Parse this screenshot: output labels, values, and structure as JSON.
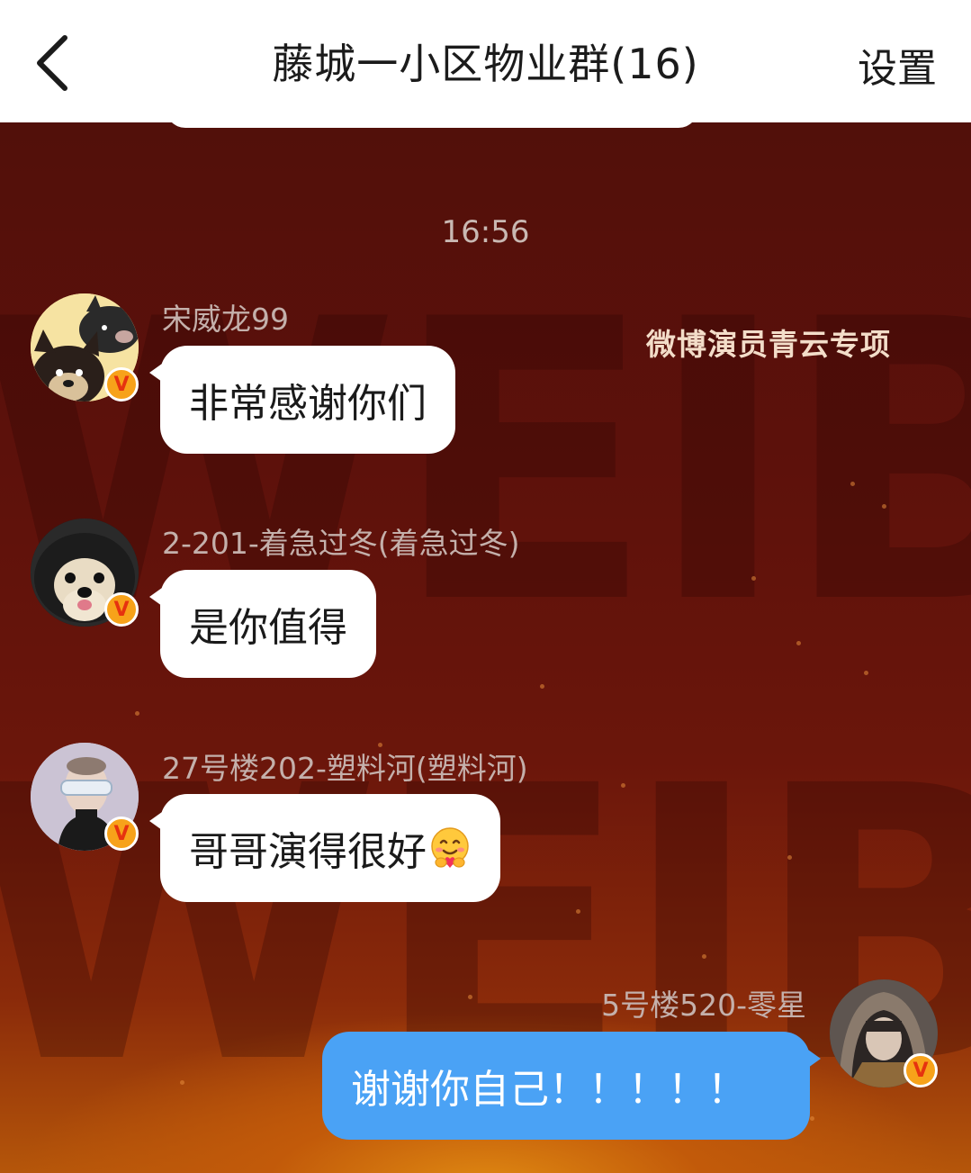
{
  "header": {
    "title": "藤城一小区物业群(16)",
    "settings_label": "设置"
  },
  "chat": {
    "timestamp": "16:56",
    "brand_tag": "微博演员青云专项",
    "watermark": [
      "WEIBO",
      "WEIBO"
    ],
    "messages": [
      {
        "sender": "宋威龙99",
        "text": "非常感谢你们",
        "side": "left",
        "avatar": "cartoon-dogs-avatar",
        "verified": "V"
      },
      {
        "sender": "2-201-着急过冬(着急过冬)",
        "text": "是你值得",
        "side": "left",
        "avatar": "pomeranian-avatar",
        "verified": "V"
      },
      {
        "sender": "27号楼202-塑料河(塑料河)",
        "text": "哥哥演得很好",
        "side": "left",
        "avatar": "person-sunglasses-avatar",
        "verified": "V",
        "emoji": "hugging-face-emoji"
      },
      {
        "sender": "5号楼520-零星",
        "text": "谢谢你自己！！！！！",
        "side": "right",
        "avatar": "hooded-person-avatar",
        "verified": "V"
      }
    ]
  },
  "colors": {
    "header_bg": "#ffffff",
    "chat_bg_top": "#4e0f0a",
    "chat_bg_bottom": "#b5560a",
    "self_bubble": "#4aa2f5",
    "other_bubble": "#ffffff",
    "verified_badge": "#f7a21a"
  }
}
